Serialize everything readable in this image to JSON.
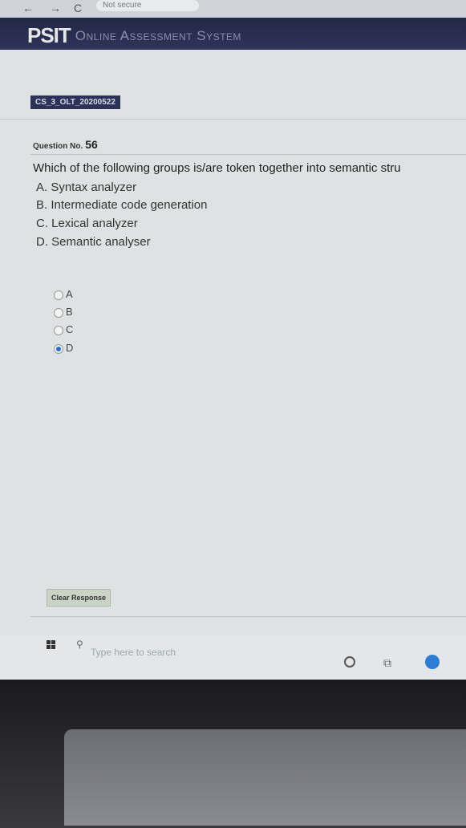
{
  "browser": {
    "back_icon": "←",
    "forward_icon": "→",
    "reload_icon": "C",
    "address": "Not secure"
  },
  "header": {
    "brand": "PSIT",
    "subtitle": "Online Assessment System"
  },
  "test": {
    "code": "CS_3_OLT_20200522"
  },
  "question": {
    "label": "Question No.",
    "number": "56",
    "text": "Which of the following groups is/are token together into semantic stru",
    "options": [
      "A. Syntax analyzer",
      "B. Intermediate code generation",
      "C. Lexical analyzer",
      "D. Semantic analyser"
    ]
  },
  "answers": [
    {
      "label": "A",
      "checked": false
    },
    {
      "label": "B",
      "checked": false
    },
    {
      "label": "C",
      "checked": false
    },
    {
      "label": "D",
      "checked": true
    }
  ],
  "actions": {
    "clear_response": "Clear Response"
  },
  "taskbar": {
    "search_placeholder": "Type here to search",
    "icons": [
      "windows-icon",
      "search-icon",
      "cortana-icon",
      "task-view-icon",
      "edge-icon"
    ]
  }
}
